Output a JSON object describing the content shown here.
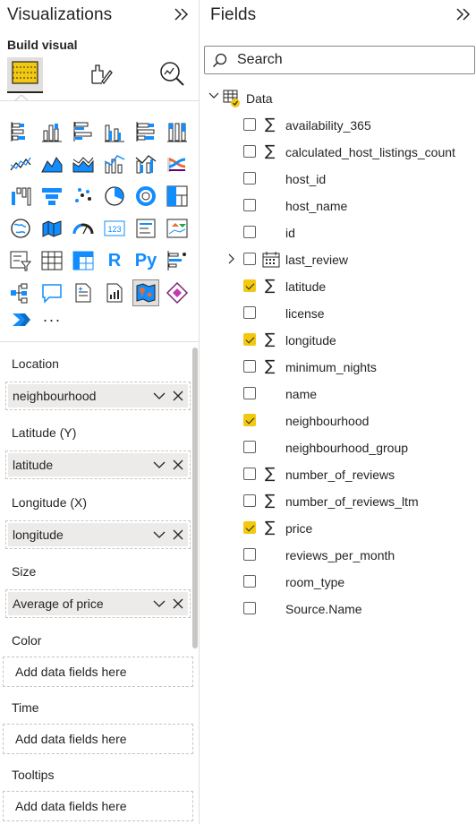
{
  "viz_pane": {
    "title": "Visualizations",
    "build_visual_label": "Build visual",
    "tabs": [
      {
        "name": "build-visual",
        "icon": "build-visual-icon",
        "active": true
      },
      {
        "name": "format-visual",
        "icon": "format-paintbrush-icon",
        "active": false
      },
      {
        "name": "analytics",
        "icon": "analytics-magnifier-icon",
        "active": false
      }
    ],
    "visual_types": [
      "stacked-bar-chart-icon",
      "stacked-column-chart-icon",
      "clustered-bar-chart-icon",
      "clustered-column-chart-icon",
      "100-stacked-bar-chart-icon",
      "100-stacked-column-chart-icon",
      "line-chart-icon",
      "area-chart-icon",
      "stacked-area-chart-icon",
      "line-stacked-column-chart-icon",
      "line-clustered-column-chart-icon",
      "ribbon-chart-icon",
      "waterfall-chart-icon",
      "funnel-chart-icon",
      "scatter-chart-icon",
      "pie-chart-icon",
      "donut-chart-icon",
      "treemap-icon",
      "map-icon",
      "filled-map-icon",
      "gauge-icon",
      "card-icon",
      "multi-row-card-icon",
      "kpi-icon",
      "slicer-icon",
      "table-icon",
      "matrix-icon",
      "r-script-visual-icon",
      "python-visual-icon",
      "key-influencers-icon",
      "decomposition-tree-icon",
      "qa-icon",
      "smart-narrative-icon",
      "paginated-report-icon",
      "azure-map-icon",
      "power-apps-icon",
      "power-automate-icon",
      "more-visuals-icon"
    ],
    "r_label": "R",
    "py_label": "Py",
    "card_label": "123",
    "more_label": "···",
    "wells": [
      {
        "label": "Location",
        "value": "neighbourhood"
      },
      {
        "label": "Latitude (Y)",
        "value": "latitude"
      },
      {
        "label": "Longitude (X)",
        "value": "longitude"
      },
      {
        "label": "Size",
        "value": "Average of price"
      },
      {
        "label": "Color",
        "placeholder": "Add data fields here"
      },
      {
        "label": "Time",
        "placeholder": "Add data fields here"
      },
      {
        "label": "Tooltips",
        "placeholder": "Add data fields here"
      }
    ]
  },
  "fields_pane": {
    "title": "Fields",
    "search_placeholder": "Search",
    "table_name": "Data",
    "fields": [
      {
        "name": "availability_365",
        "numeric": true,
        "checked": false
      },
      {
        "name": "calculated_host_listings_count",
        "numeric": true,
        "checked": false
      },
      {
        "name": "host_id",
        "numeric": false,
        "checked": false
      },
      {
        "name": "host_name",
        "numeric": false,
        "checked": false
      },
      {
        "name": "id",
        "numeric": false,
        "checked": false
      },
      {
        "name": "last_review",
        "numeric": false,
        "checked": false,
        "date": true
      },
      {
        "name": "latitude",
        "numeric": true,
        "checked": true
      },
      {
        "name": "license",
        "numeric": false,
        "checked": false
      },
      {
        "name": "longitude",
        "numeric": true,
        "checked": true
      },
      {
        "name": "minimum_nights",
        "numeric": true,
        "checked": false
      },
      {
        "name": "name",
        "numeric": false,
        "checked": false
      },
      {
        "name": "neighbourhood",
        "numeric": false,
        "checked": true
      },
      {
        "name": "neighbourhood_group",
        "numeric": false,
        "checked": false
      },
      {
        "name": "number_of_reviews",
        "numeric": true,
        "checked": false
      },
      {
        "name": "number_of_reviews_ltm",
        "numeric": true,
        "checked": false
      },
      {
        "name": "price",
        "numeric": true,
        "checked": true
      },
      {
        "name": "reviews_per_month",
        "numeric": false,
        "checked": false
      },
      {
        "name": "room_type",
        "numeric": false,
        "checked": false
      },
      {
        "name": "Source.Name",
        "numeric": false,
        "checked": false
      }
    ],
    "sigma_glyph": "∑"
  },
  "colors": {
    "accent_yellow": "#f2c811",
    "icon_blue": "#118dff",
    "icon_dark": "#252423",
    "well_bg": "#edebe9",
    "border": "#e1dfdd"
  }
}
